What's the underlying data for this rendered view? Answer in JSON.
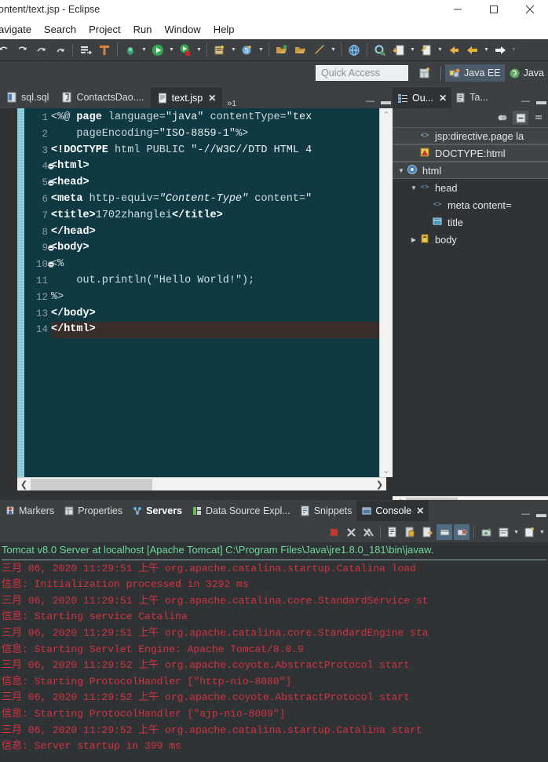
{
  "window": {
    "title": "ontent/text.jsp - Eclipse",
    "controls": {
      "minimize": "minimize-icon",
      "maximize": "maximize-icon",
      "close": "close-icon"
    }
  },
  "menubar": {
    "items": [
      "avigate",
      "Search",
      "Project",
      "Run",
      "Window",
      "Help"
    ]
  },
  "quick_access": {
    "placeholder": "Quick Access",
    "value": ""
  },
  "perspectives": {
    "open_perspective_label": "open-perspective-icon",
    "tabs": [
      {
        "label": "Java EE",
        "active": true,
        "icon": "java-ee-icon"
      },
      {
        "label": "Java",
        "active": false,
        "icon": "java-icon"
      }
    ]
  },
  "editor": {
    "tabs": [
      {
        "label": "sql.sql",
        "icon": "sql-file-icon",
        "active": false,
        "closable": false
      },
      {
        "label": "ContactsDao....",
        "icon": "java-file-icon",
        "active": false,
        "closable": false
      },
      {
        "label": "text.jsp",
        "icon": "jsp-file-icon",
        "active": true,
        "closable": true
      }
    ],
    "overflow_label": "»",
    "overflow_count": "1",
    "controls": {
      "minimize": "minimize-view-icon",
      "maximize": "maximize-view-icon"
    },
    "lines": [
      {
        "num": "1",
        "fold": false,
        "current": false,
        "tokens": [
          {
            "t": "<%@ ",
            "c": "pln"
          },
          {
            "t": "page",
            "c": "kw"
          },
          {
            "t": " language=",
            "c": "attr"
          },
          {
            "t": "\"java\"",
            "c": "str"
          },
          {
            "t": " contentType=",
            "c": "attr"
          },
          {
            "t": "\"tex",
            "c": "str"
          }
        ]
      },
      {
        "num": "2",
        "fold": false,
        "current": false,
        "tokens": [
          {
            "t": "    pageEncoding=",
            "c": "attr"
          },
          {
            "t": "\"ISO-8859-1\"",
            "c": "str"
          },
          {
            "t": "%>",
            "c": "pln"
          }
        ]
      },
      {
        "num": "3",
        "fold": false,
        "current": false,
        "tokens": [
          {
            "t": "<!DOCTYPE",
            "c": "kw"
          },
          {
            "t": " html PUBLIC ",
            "c": "attr"
          },
          {
            "t": "\"-//W3C//DTD HTML 4",
            "c": "str"
          }
        ]
      },
      {
        "num": "4",
        "fold": true,
        "current": false,
        "tokens": [
          {
            "t": "<html>",
            "c": "kw"
          }
        ]
      },
      {
        "num": "5",
        "fold": true,
        "current": false,
        "tokens": [
          {
            "t": "<head>",
            "c": "kw"
          }
        ]
      },
      {
        "num": "6",
        "fold": false,
        "current": false,
        "tokens": [
          {
            "t": "<meta",
            "c": "kw"
          },
          {
            "t": " http-equiv=",
            "c": "attr"
          },
          {
            "t": "\"Content-Type\"",
            "c": "stri"
          },
          {
            "t": " content=",
            "c": "attr"
          },
          {
            "t": "\"",
            "c": "str"
          }
        ]
      },
      {
        "num": "7",
        "fold": false,
        "current": false,
        "tokens": [
          {
            "t": "<title>",
            "c": "kw"
          },
          {
            "t": "1702zhanglei",
            "c": "pln"
          },
          {
            "t": "</title>",
            "c": "kw"
          }
        ]
      },
      {
        "num": "8",
        "fold": false,
        "current": false,
        "tokens": [
          {
            "t": "</head>",
            "c": "kw"
          }
        ]
      },
      {
        "num": "9",
        "fold": true,
        "current": false,
        "tokens": [
          {
            "t": "<body>",
            "c": "kw"
          }
        ]
      },
      {
        "num": "10",
        "fold": true,
        "current": false,
        "tokens": [
          {
            "t": "<%",
            "c": "pln"
          }
        ]
      },
      {
        "num": "11",
        "fold": false,
        "current": false,
        "tokens": [
          {
            "t": "    out.println(\"Hello World!\");",
            "c": "pln"
          }
        ]
      },
      {
        "num": "12",
        "fold": false,
        "current": false,
        "tokens": [
          {
            "t": "%>",
            "c": "pln"
          }
        ]
      },
      {
        "num": "13",
        "fold": false,
        "current": false,
        "tokens": [
          {
            "t": "</body>",
            "c": "kw"
          }
        ]
      },
      {
        "num": "14",
        "fold": false,
        "current": true,
        "tokens": [
          {
            "t": "</html>",
            "c": "kw"
          }
        ]
      }
    ]
  },
  "outline": {
    "tabs": [
      {
        "label": "Ou...",
        "icon": "outline-icon",
        "active": true,
        "closable": true
      },
      {
        "label": "Ta...",
        "icon": "task-list-icon",
        "active": false,
        "closable": false
      }
    ],
    "toolbar": [
      {
        "name": "hide-nonpublic-icon",
        "selected": false
      },
      {
        "name": "collapse-all-icon",
        "selected": true
      }
    ],
    "tree": [
      {
        "label": "jsp:directive.page la",
        "indent": 1,
        "twisty": "",
        "icon": "jsp-directive-icon",
        "band": true
      },
      {
        "label": "DOCTYPE:html",
        "indent": 1,
        "twisty": "",
        "icon": "doctype-icon",
        "band": true
      },
      {
        "label": "html",
        "indent": 0,
        "twisty": "▼",
        "icon": "html-element-icon",
        "band": true
      },
      {
        "label": "head",
        "indent": 1,
        "twisty": "▼",
        "icon": "element-icon",
        "band": false
      },
      {
        "label": "meta content=",
        "indent": 2,
        "twisty": "",
        "icon": "element-icon",
        "band": false
      },
      {
        "label": "title",
        "indent": 2,
        "twisty": "",
        "icon": "title-element-icon",
        "band": false
      },
      {
        "label": "body",
        "indent": 1,
        "twisty": "▶",
        "icon": "body-element-icon",
        "band": false
      }
    ]
  },
  "bottom_panel": {
    "tabs": [
      {
        "label": "Markers",
        "icon": "markers-icon",
        "active": false,
        "bold": false
      },
      {
        "label": "Properties",
        "icon": "properties-icon",
        "active": false,
        "bold": false
      },
      {
        "label": "Servers",
        "icon": "servers-icon",
        "active": false,
        "bold": true
      },
      {
        "label": "Data Source Expl...",
        "icon": "data-source-icon",
        "active": false,
        "bold": false
      },
      {
        "label": "Snippets",
        "icon": "snippets-icon",
        "active": false,
        "bold": false
      },
      {
        "label": "Console",
        "icon": "console-icon",
        "active": true,
        "bold": false,
        "closable": true
      }
    ],
    "controls": {
      "minimize": "minimize-view-icon",
      "maximize": "maximize-view-icon"
    },
    "toolbar": [
      "terminate-icon",
      "remove-launch-icon",
      "remove-all-launches-icon",
      "clear-console-icon",
      "scroll-lock-icon",
      "word-wrap-icon",
      "show-console-on-output-icon",
      "show-console-on-error-icon",
      "pin-console-icon",
      "display-selected-console-icon",
      "display-selected-console-dropdown-icon",
      "open-console-icon",
      "open-console-dropdown-icon"
    ]
  },
  "console": {
    "header": "Tomcat v8.0 Server at localhost [Apache Tomcat] C:\\Program Files\\Java\\jre1.8.0_181\\bin\\javaw.",
    "lines": [
      "三月 06, 2020 11:29:51 上午 org.apache.catalina.startup.Catalina load",
      "信息: Initialization processed in 3292 ms",
      "三月 06, 2020 11:29:51 上午 org.apache.catalina.core.StandardService st",
      "信息: Starting service Catalina",
      "三月 06, 2020 11:29:51 上午 org.apache.catalina.core.StandardEngine sta",
      "信息: Starting Servlet Engine: Apache Tomcat/8.0.9",
      "三月 06, 2020 11:29:52 上午 org.apache.coyote.AbstractProtocol start",
      "信息: Starting ProtocolHandler [\"http-nio-8080\"]",
      "三月 06, 2020 11:29:52 上午 org.apache.coyote.AbstractProtocol start",
      "信息: Starting ProtocolHandler [\"ajp-nio-8009\"]",
      "三月 06, 2020 11:29:52 上午 org.apache.catalina.startup.Catalina start",
      "信息: Server startup in 399 ms"
    ]
  },
  "colors": {
    "editor_bg": "#0f3a44",
    "chrome_bg": "#3c4043",
    "panel_bg": "#2f3336",
    "console_text": "#d4333f",
    "console_header": "#6fd99a",
    "accent": "#4a5a68"
  }
}
